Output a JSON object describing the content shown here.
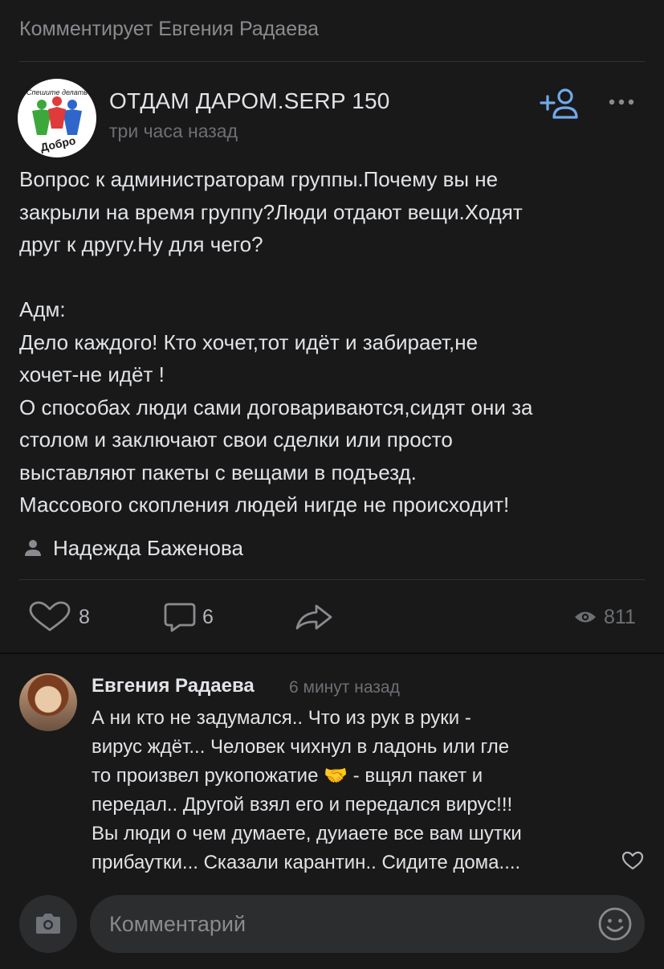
{
  "header": {
    "context": "Комментирует Евгения Радаева"
  },
  "post": {
    "group_name": "ОТДАМ ДАРОМ.SERP 150",
    "time": "три часа назад",
    "avatar_icon": "group-logo-dobro",
    "avatar_texts": {
      "top": "Спешите делать",
      "bottom": "Добро"
    },
    "text": "Вопрос к администраторам группы.Почему вы не\nзакрыли на время группу?Люди отдают вещи.Ходят\nдруг к другу.Ну для чего?\n\nАдм:\nДело каждого! Кто хочет,тот идёт и забирает,не\nхочет-не идёт !\nО способах люди сами договариваются,сидят они за\nстолом и заключают свои сделки или просто\nвыставляют пакеты с вещами в подъезд.\nМассового скопления людей нигде не происходит!",
    "author": "Надежда Баженова",
    "likes": "8",
    "comments": "6",
    "views": "811"
  },
  "comment": {
    "author": "Евгения Радаева",
    "time": "6 минут назад",
    "text": "А ни кто не задумался.. Что из рук в руки -\nвирус ждёт... Человек чихнул в ладонь или гле\nто произвел рукопожатие 🤝 - вщял пакет и\nпередал.. Другой взял его и передался вирус!!!\nВы люди о чем думаете, дуиаете все вам шутки\nприбаутки... Сказали карантин.. Сидите дома...."
  },
  "composer": {
    "placeholder": "Комментарий"
  },
  "colors": {
    "accent": "#71aaeb",
    "background": "#19191a",
    "muted": "#6d6f73"
  }
}
